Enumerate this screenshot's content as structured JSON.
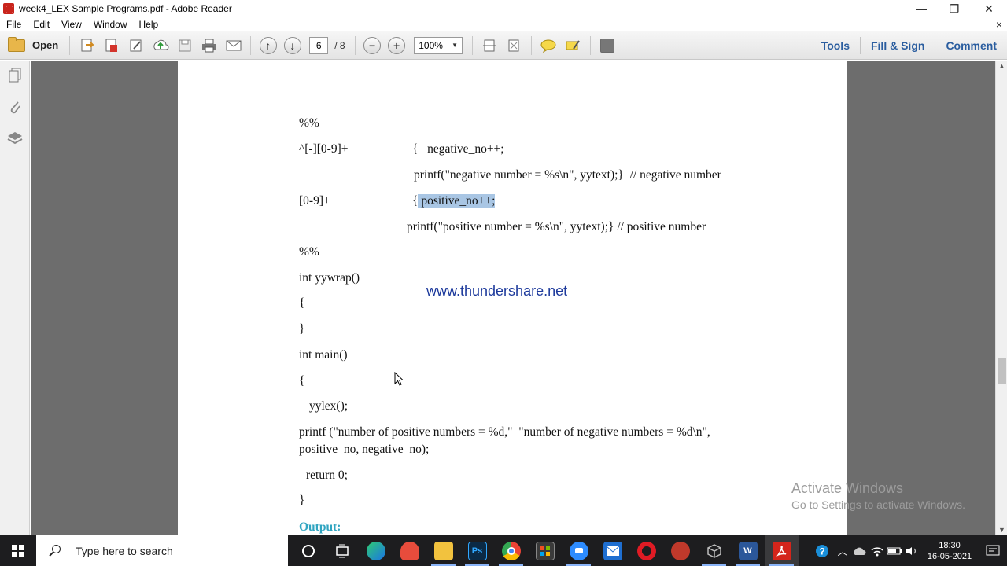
{
  "window": {
    "title": "week4_LEX Sample Programs.pdf - Adobe Reader",
    "minimize": "—",
    "restore": "❐",
    "close": "✕"
  },
  "menu": {
    "items": [
      "File",
      "Edit",
      "View",
      "Window",
      "Help"
    ],
    "close": "×"
  },
  "toolbar": {
    "open_label": "Open",
    "page_current": "6",
    "page_total": "/ 8",
    "zoom": "100%",
    "tools_label": "Tools",
    "fill_sign_label": "Fill & Sign",
    "comment_label": "Comment"
  },
  "document": {
    "lines": [
      "%%",
      "^[-][0-9]+",
      "{   negative_no++;",
      "printf(\"negative number = %s\\n\", yytext);}  // negative number",
      "[0-9]+",
      "{",
      " positive_no++;",
      "printf(\"positive number = %s\\n\", yytext);} // positive number",
      "%%",
      "int yywrap()",
      "{",
      "}",
      "int main()",
      "{",
      "yylex();",
      "printf (\"number of positive numbers = %d,\"  \"number of negative numbers = %d\\n\",",
      "positive_no, negative_no);",
      "return 0;",
      "}"
    ],
    "watermark": "www.thundershare.net",
    "output_heading": "Output:"
  },
  "activation": {
    "title": "Activate Windows",
    "subtitle": "Go to Settings to activate Windows."
  },
  "taskbar": {
    "search_placeholder": "Type here to search",
    "time": "18:30",
    "date": "16-05-2021",
    "apps": [
      "cortana-icon",
      "task-view-icon",
      "edge-icon",
      "app-icon",
      "file-explorer-icon",
      "photoshop-icon",
      "chrome-icon",
      "store-icon",
      "zoom-icon",
      "mail-icon",
      "opera-icon",
      "app-red-icon",
      "virtualbox-icon",
      "word-icon",
      "acrobat-icon"
    ],
    "ps_label": "Ps",
    "word_label": "W"
  },
  "colors": {
    "link_blue": "#2a5d9f",
    "highlight": "#a9c6e4",
    "watermark": "#1d3a9c",
    "output_heading": "#31a5c1",
    "doc_background": "#6d6d6d"
  }
}
